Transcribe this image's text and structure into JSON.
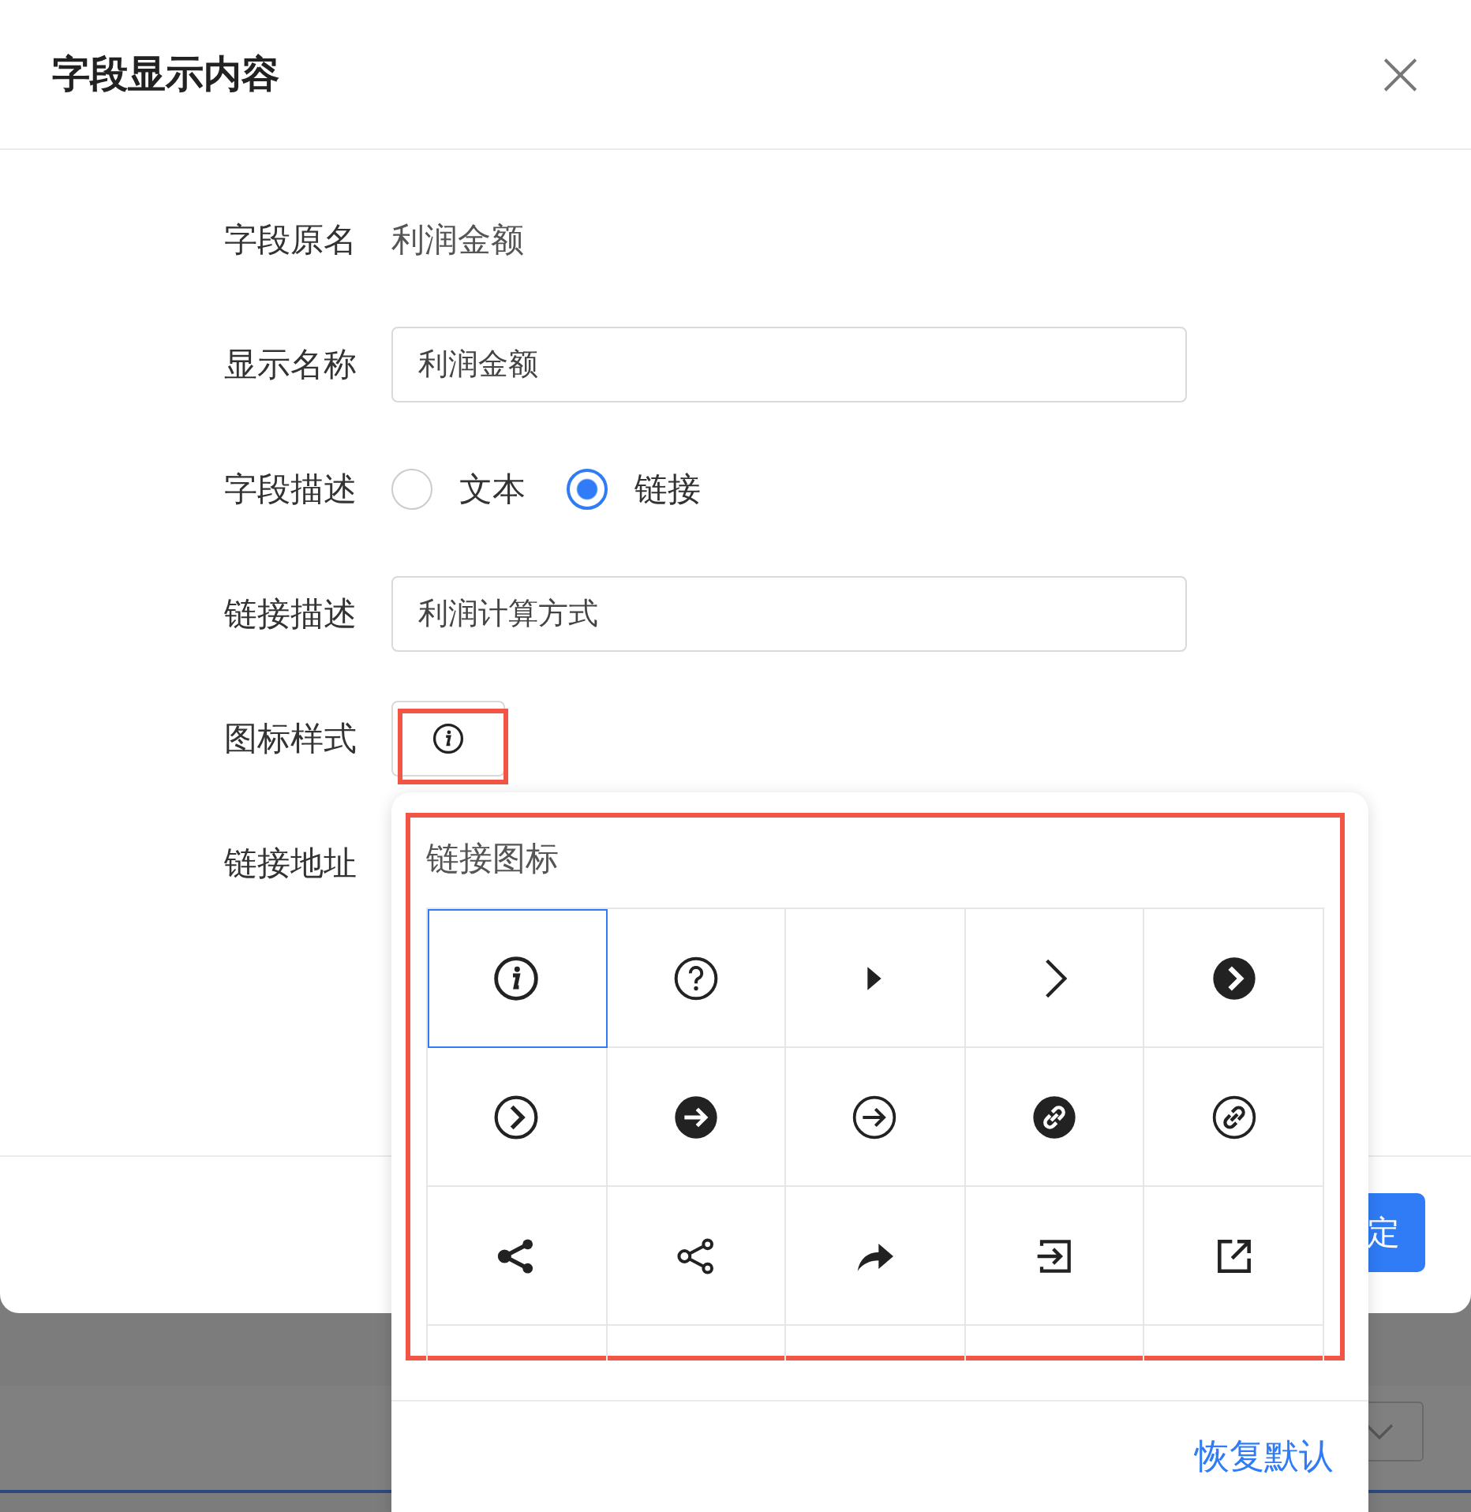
{
  "dialog": {
    "title": "字段显示内容",
    "close": "×"
  },
  "form": [
    {
      "kind": "text",
      "label": "字段原名",
      "value": "利润金额"
    },
    {
      "kind": "input",
      "label": "显示名称",
      "value": "利润金额"
    },
    {
      "kind": "radio",
      "label": "字段描述",
      "options": [
        {
          "label": "文本",
          "selected": false
        },
        {
          "label": "链接",
          "selected": true
        }
      ]
    },
    {
      "kind": "input",
      "label": "链接描述",
      "value": "利润计算方式"
    },
    {
      "kind": "icon",
      "label": "图标样式"
    },
    {
      "kind": "empty",
      "label": "链接地址"
    }
  ],
  "confirm_button": "定",
  "popover": {
    "title": "链接图标",
    "icons": [
      {
        "kind": "info",
        "selected": true
      },
      {
        "kind": "question",
        "selected": false
      },
      {
        "kind": "triangle",
        "selected": false
      },
      {
        "kind": "chevron",
        "selected": false
      },
      {
        "kind": "chevron-solid",
        "selected": false
      },
      {
        "kind": "chevron-circle",
        "selected": false
      },
      {
        "kind": "arrow-solid",
        "selected": false
      },
      {
        "kind": "arrow-circle",
        "selected": false
      },
      {
        "kind": "link-solid",
        "selected": false
      },
      {
        "kind": "link-circle",
        "selected": false
      },
      {
        "kind": "share-solid",
        "selected": false
      },
      {
        "kind": "share",
        "selected": false
      },
      {
        "kind": "forward",
        "selected": false
      },
      {
        "kind": "sign-in",
        "selected": false
      },
      {
        "kind": "external",
        "selected": false
      },
      {
        "kind": "blank",
        "selected": false
      },
      {
        "kind": "blank",
        "selected": false
      },
      {
        "kind": "blank",
        "selected": false
      },
      {
        "kind": "blank",
        "selected": false
      },
      {
        "kind": "blank",
        "selected": false
      }
    ],
    "reset_link": "恢复默认"
  }
}
